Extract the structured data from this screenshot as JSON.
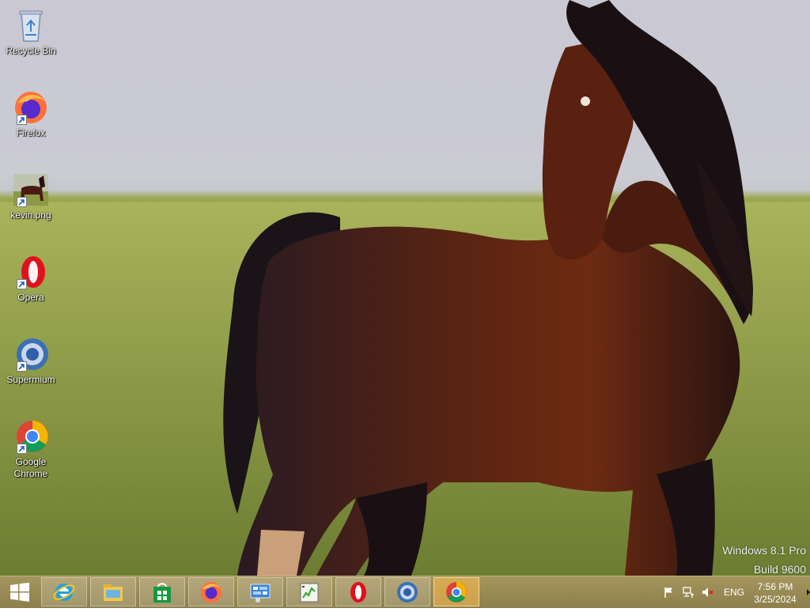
{
  "desktop": {
    "icons": [
      {
        "label": "Recycle Bin",
        "icon": "recycle-bin-icon",
        "shortcut": false
      },
      {
        "label": "Firefox",
        "icon": "firefox-icon",
        "shortcut": true
      },
      {
        "label": "kevin.png",
        "icon": "image-file-icon",
        "shortcut": true
      },
      {
        "label": "Opera",
        "icon": "opera-icon",
        "shortcut": true
      },
      {
        "label": "Supermium",
        "icon": "supermium-icon",
        "shortcut": true
      },
      {
        "label": "Google Chrome",
        "icon": "chrome-icon",
        "shortcut": true
      }
    ],
    "watermark": {
      "line1": "Windows 8.1 Pro",
      "line2": "Build 9600"
    }
  },
  "taskbar": {
    "buttons": [
      {
        "name": "internet-explorer",
        "icon": "internet-explorer-icon",
        "active": false
      },
      {
        "name": "file-explorer",
        "icon": "file-explorer-icon",
        "active": false
      },
      {
        "name": "store",
        "icon": "store-icon",
        "active": false
      },
      {
        "name": "firefox",
        "icon": "firefox-icon",
        "active": false
      },
      {
        "name": "control-panel",
        "icon": "control-panel-icon",
        "active": false
      },
      {
        "name": "task-manager",
        "icon": "task-manager-icon",
        "active": false
      },
      {
        "name": "opera",
        "icon": "opera-icon",
        "active": false
      },
      {
        "name": "supermium",
        "icon": "supermium-icon",
        "active": false
      },
      {
        "name": "chrome",
        "icon": "chrome-icon",
        "active": true
      }
    ],
    "tray": {
      "language": "ENG",
      "time": "7:56 PM",
      "date": "3/25/2024",
      "icons": [
        "flag-icon",
        "network-icon",
        "volume-muted-icon"
      ]
    },
    "colors": {
      "bar": "#9a8b55",
      "active_button": "#f0b860"
    }
  }
}
